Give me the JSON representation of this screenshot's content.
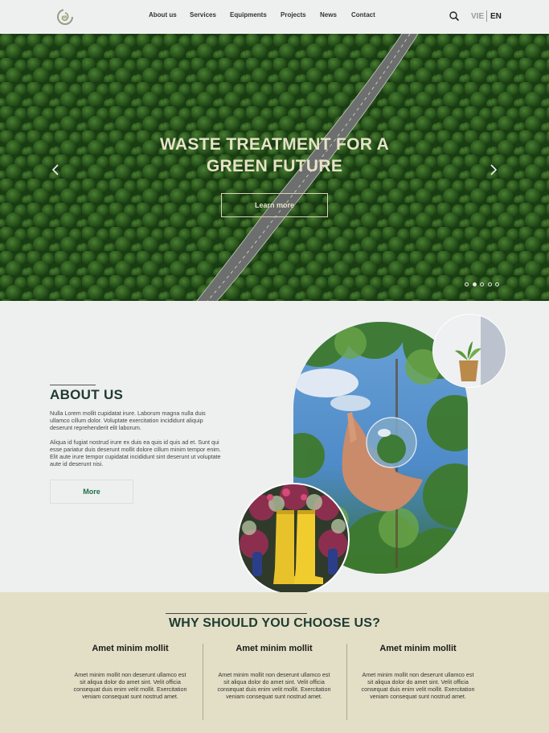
{
  "header": {
    "logo": "leaf-swirl-logo",
    "nav": [
      "About us",
      "Services",
      "Equipments",
      "Projects",
      "News",
      "Contact"
    ],
    "search_icon": "search-icon",
    "lang_vie": "VIE",
    "lang_en": "EN"
  },
  "hero": {
    "title_line1": "WASTE TREATMENT FOR A",
    "title_line2": "GREEN FUTURE",
    "button_label": "Learn more",
    "slides_total": 5,
    "active_slide": 2
  },
  "about": {
    "title": "ABOUT US",
    "paragraph1": "Nulla Lorem mollit cupidatat irure. Laborum magna nulla duis ullamco cillum dolor. Voluptate exercitation incididunt aliquip deserunt reprehenderit elit laborum.",
    "paragraph2": "Aliqua id fugiat nostrud irure ex duis ea quis id quis ad et. Sunt qui esse pariatur duis deserunt mollit dolore cillum minim tempor enim. Elit aute irure tempor cupidatat incididunt sint deserunt ut voluptate aute id deserunt nisi.",
    "more_label": "More"
  },
  "why": {
    "title": "WHY SHOULD YOU CHOOSE US?",
    "columns": [
      {
        "heading": "Amet minim mollit",
        "text": "Amet minim mollit non deserunt ullamco est sit aliqua dolor do amet sint. Velit officia consequat duis enim velit mollit. Exercitation veniam consequat sunt nostrud amet."
      },
      {
        "heading": "Amet minim mollit",
        "text": "Amet minim mollit non deserunt ullamco est sit aliqua dolor do amet sint. Velit officia consequat duis enim velit mollit. Exercitation veniam consequat sunt nostrud amet."
      },
      {
        "heading": "Amet minim mollit",
        "text": "Amet minim mollit non deserunt ullamco est sit aliqua dolor do amet sint. Velit officia consequat duis enim velit mollit. Exercitation veniam consequat sunt nostrud amet."
      }
    ]
  },
  "colors": {
    "background": "#eef0f0",
    "forest": "#1f4d17",
    "hero_text": "#e6e3c6",
    "heading_dark_green": "#213a32",
    "button_green": "#1e6e48",
    "why_background": "#e3dfc6"
  }
}
